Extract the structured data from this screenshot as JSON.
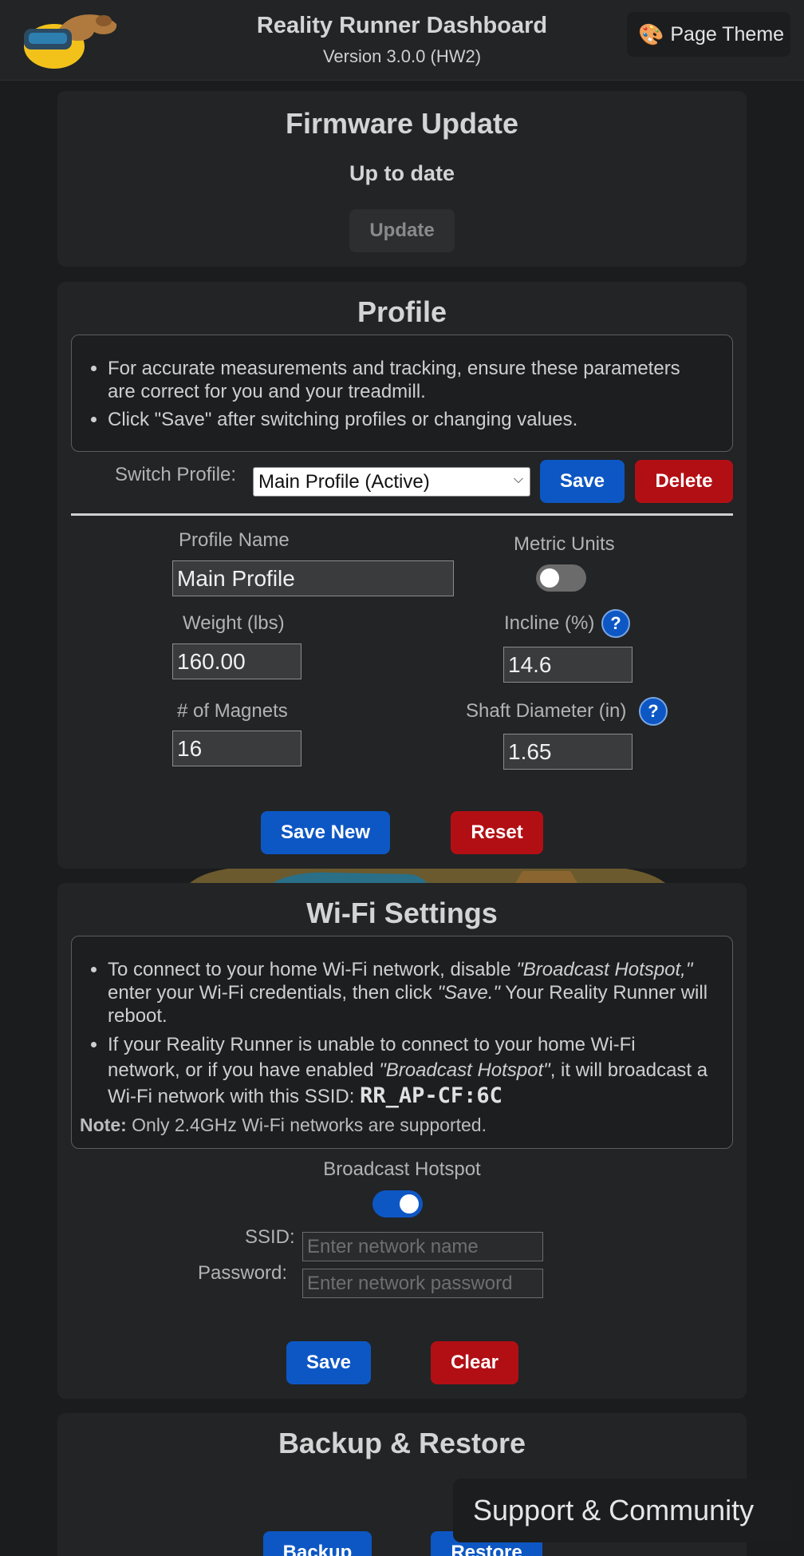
{
  "header": {
    "title": "Reality Runner Dashboard",
    "version": "Version 3.0.0 (HW2)",
    "theme_button": "Page Theme"
  },
  "firmware": {
    "title": "Firmware Update",
    "status": "Up to date",
    "update_button": "Update"
  },
  "profile": {
    "title": "Profile",
    "info_1": "For accurate measurements and tracking, ensure these parameters are correct for you and your treadmill.",
    "info_2": "Click \"Save\" after switching profiles or changing values.",
    "switch_label": "Switch Profile:",
    "selected_profile": "Main Profile (Active)",
    "save_button": "Save",
    "delete_button": "Delete",
    "name_label": "Profile Name",
    "name_value": "Main Profile",
    "metric_label": "Metric Units",
    "metric_on": false,
    "weight_label": "Weight (lbs)",
    "weight_value": "160.00",
    "incline_label": "Incline (%)",
    "incline_value": "14.6",
    "magnets_label": "# of Magnets",
    "magnets_value": "16",
    "shaft_label": "Shaft Diameter (in)",
    "shaft_value": "1.65",
    "help_glyph": "?",
    "save_new_button": "Save New",
    "reset_button": "Reset"
  },
  "wifi": {
    "title": "Wi-Fi Settings",
    "b1_pre": "To connect to your home Wi-Fi network, disable ",
    "b1_em1": "\"Broadcast Hotspot,\"",
    "b1_mid": " enter your Wi-Fi credentials, then click ",
    "b1_em2": "\"Save.\"",
    "b1_post": " Your Reality Runner will reboot.",
    "b2_pre": "If your Reality Runner is unable to connect to your home Wi-Fi network, or if you have enabled ",
    "b2_em": "\"Broadcast Hotspot\"",
    "b2_post": ", it will broadcast a Wi-Fi network with this SSID: ",
    "ssid_code": "RR_AP-CF:6C",
    "note_label": "Note:",
    "note_text": " Only 2.4GHz Wi-Fi networks are supported.",
    "hotspot_label": "Broadcast Hotspot",
    "hotspot_on": true,
    "ssid_label": "SSID:",
    "ssid_placeholder": "Enter network name",
    "password_label": "Password:",
    "password_placeholder": "Enter network password",
    "save_button": "Save",
    "clear_button": "Clear"
  },
  "backup": {
    "title": "Backup & Restore",
    "backup_button": "Backup",
    "restore_button": "Restore"
  },
  "support_button": "Support & Community",
  "colors": {
    "primary_blue": "#0d57c4",
    "danger_red": "#b20f14",
    "card_bg": "#222426",
    "page_bg": "#1a1c1e"
  }
}
